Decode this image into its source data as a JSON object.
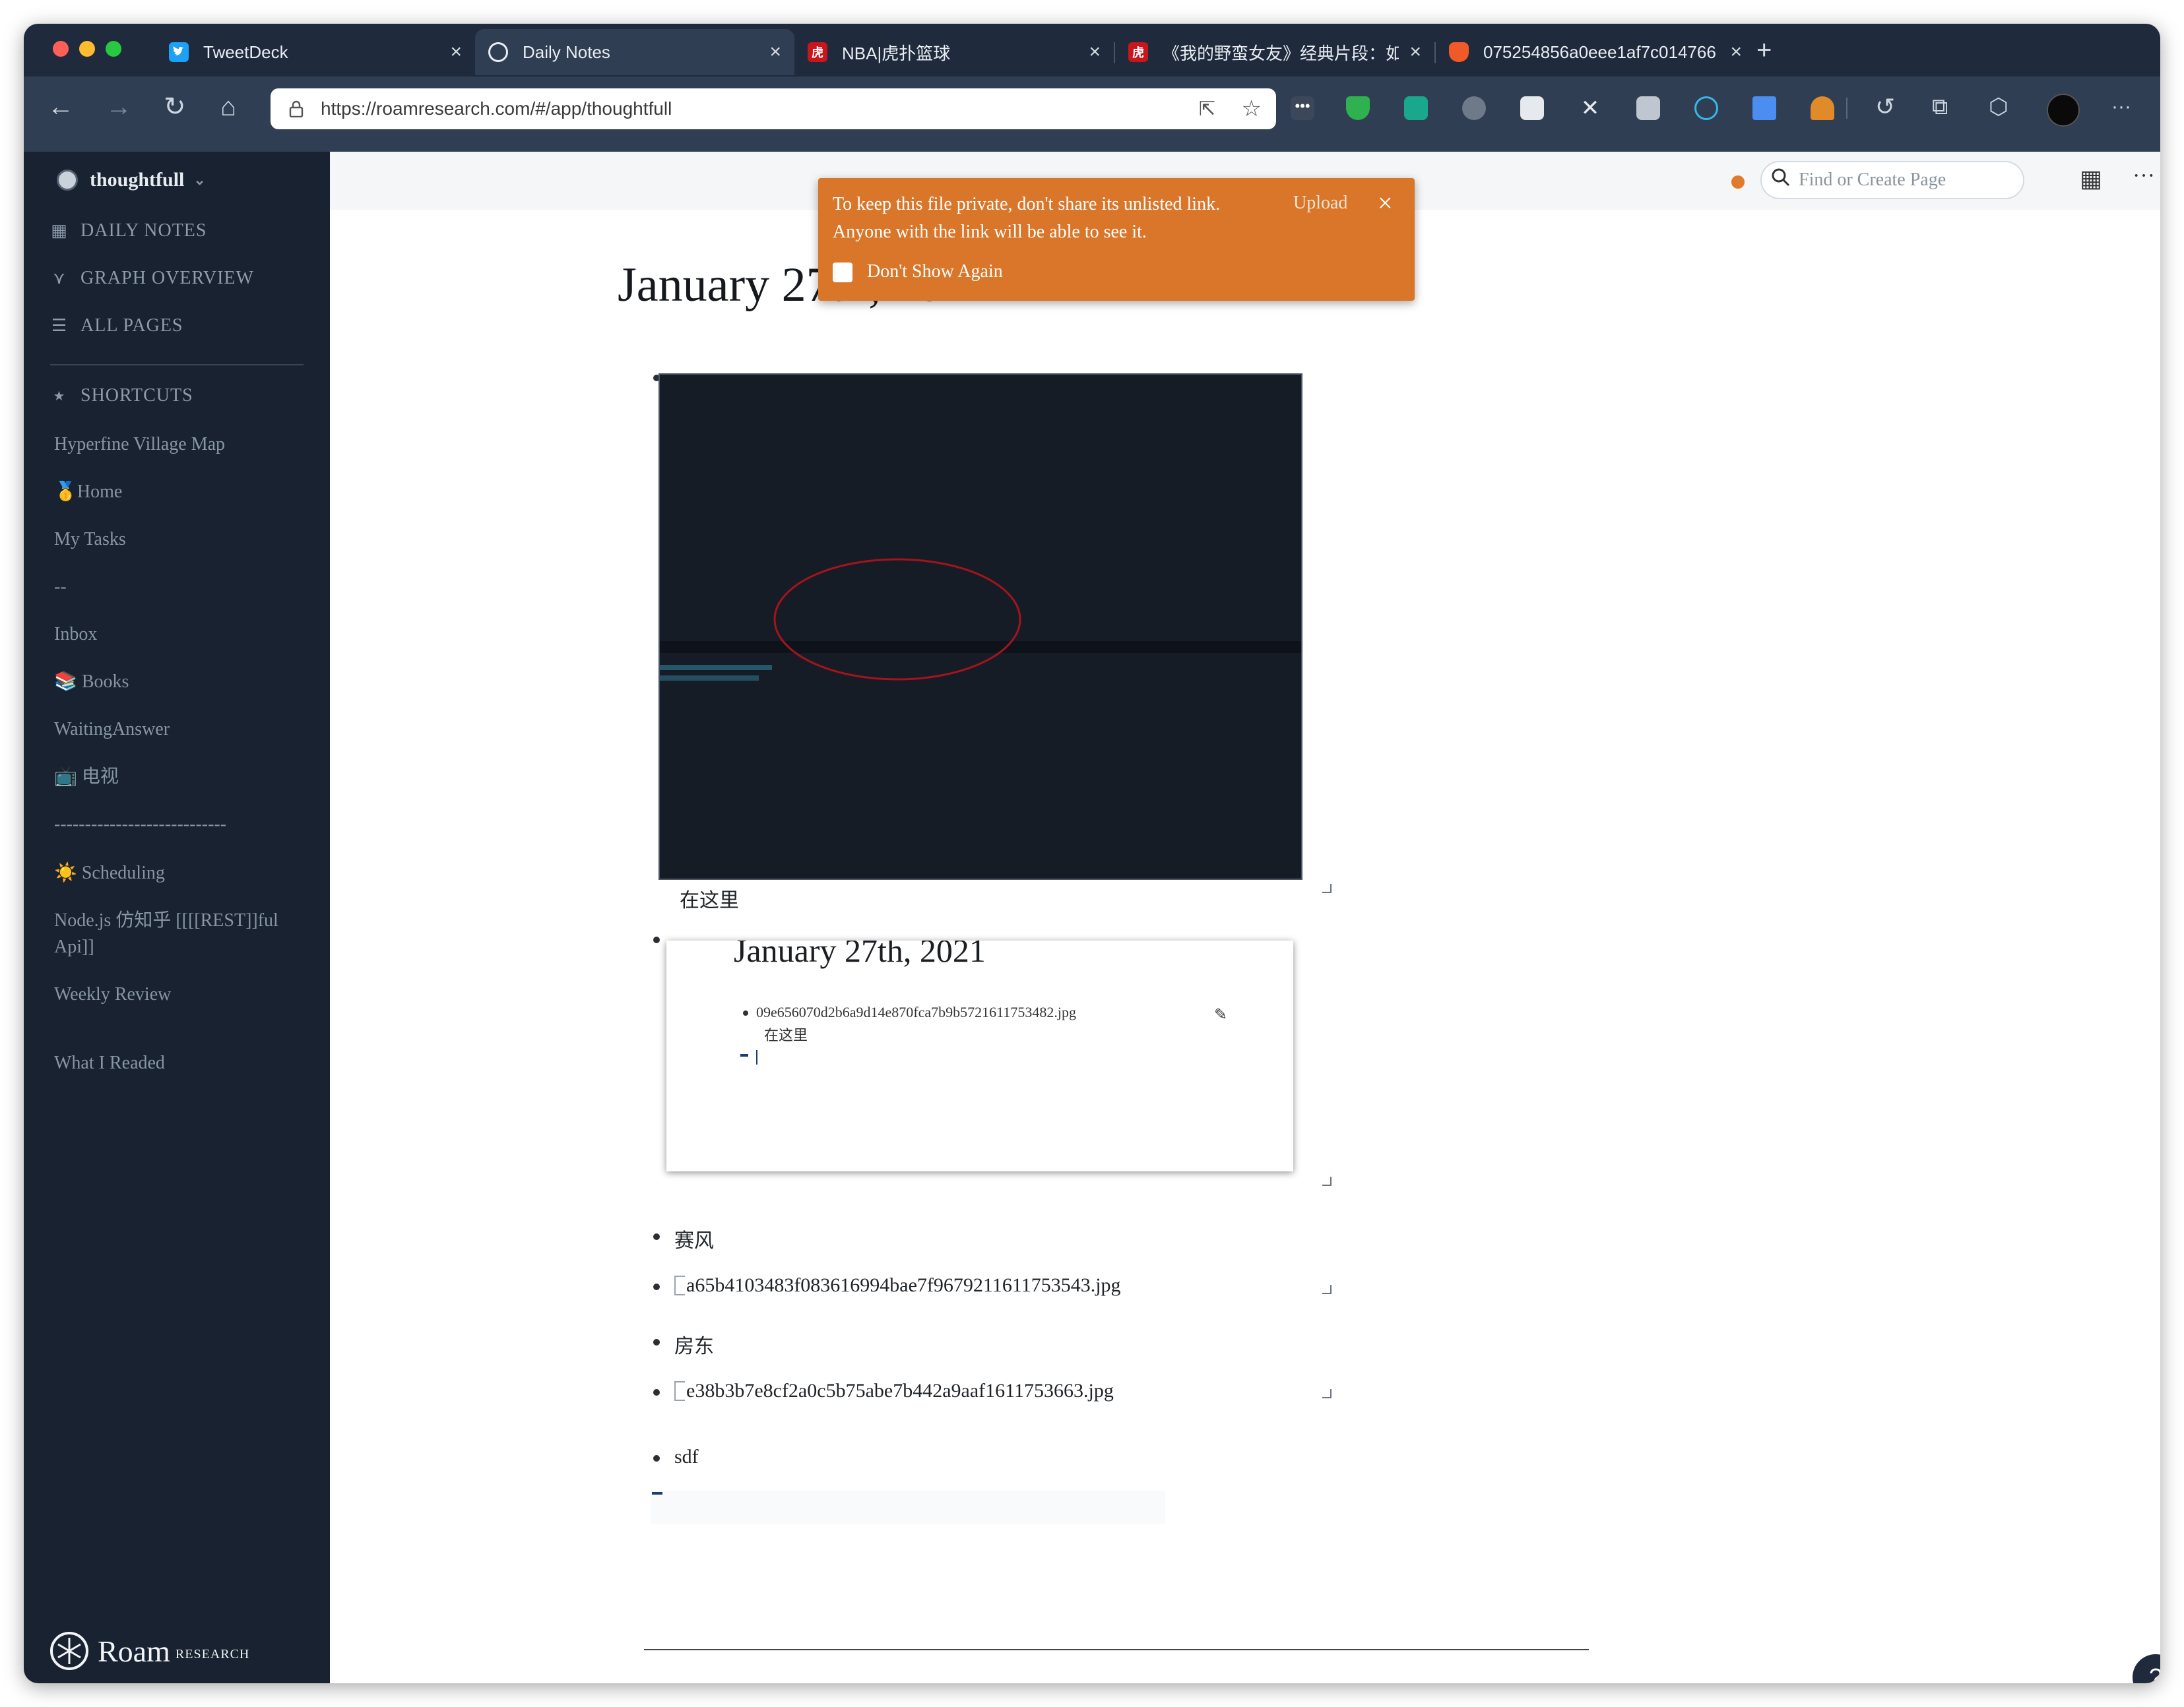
{
  "browser": {
    "tabs": [
      {
        "title": "TweetDeck",
        "icon": "twitter-icon",
        "color": "#1da1f2"
      },
      {
        "title": "Daily Notes",
        "icon": "roam-icon",
        "color": "#ffffff",
        "active": true
      },
      {
        "title": "NBA|虎扑篮球",
        "icon": "hupu-icon",
        "color": "#c8161d"
      },
      {
        "title": "《我的野蛮女友》经典片段：如",
        "icon": "hupu-icon",
        "color": "#c8161d"
      },
      {
        "title": "075254856a0eee1af7c014766",
        "icon": "brave-icon",
        "color": "#f05a28"
      }
    ],
    "close_glyph": "×",
    "new_tab_glyph": "+",
    "url": "https://roamresearch.com/#/app/thoughtfull",
    "url_host": "roamresearch.com"
  },
  "sidebar": {
    "graph_name": "thoughtfull",
    "nav": [
      {
        "label": "DAILY NOTES",
        "icon": "calendar-icon"
      },
      {
        "label": "GRAPH OVERVIEW",
        "icon": "graph-icon"
      },
      {
        "label": "ALL PAGES",
        "icon": "list-icon"
      }
    ],
    "shortcuts_label": "SHORTCUTS",
    "shortcuts": [
      "Hyperfine Village Map",
      "🥇Home",
      "My Tasks",
      "--",
      "Inbox",
      "📚 Books",
      "WaitingAnswer",
      "📺 电视",
      "----------------------------",
      "☀️ Scheduling",
      "Node.js 仿知乎 [[[[REST]]ful Api]]",
      "Weekly Review",
      "What I Readed"
    ],
    "logo_text": "Roam",
    "logo_sub": "RESEARCH"
  },
  "topbar": {
    "search_placeholder": "Find or Create Page"
  },
  "toast": {
    "message_line1": "To keep this file private, don't share its unlisted link.",
    "message_line2": "Anyone with the link will be able to see it.",
    "upload_label": "Upload",
    "checkbox_label": "Don't Show Again"
  },
  "page": {
    "title": "January 27th, 2021",
    "caption": "在这里",
    "embedded": {
      "title": "January 27th, 2021",
      "filename": "09e656070d2b6a9d14e870fca7b9b5721611753482.jpg",
      "caption": "在这里"
    },
    "blocks": [
      {
        "text": "赛风"
      },
      {
        "text": "a65b4103483f083616994bae7f9679211611753543.jpg",
        "broken_image": true
      },
      {
        "text": "房东"
      },
      {
        "text": "e38b3b7e8cf2a0c5b75abe7b442a9aaf1611753663.jpg",
        "broken_image": true
      },
      {
        "text": "sdf"
      }
    ]
  },
  "colors": {
    "accent": "#d9762a",
    "sidebar_bg": "#182230",
    "tab_bg": "#1f2b3c",
    "toolbar_bg": "#2f3e52"
  }
}
